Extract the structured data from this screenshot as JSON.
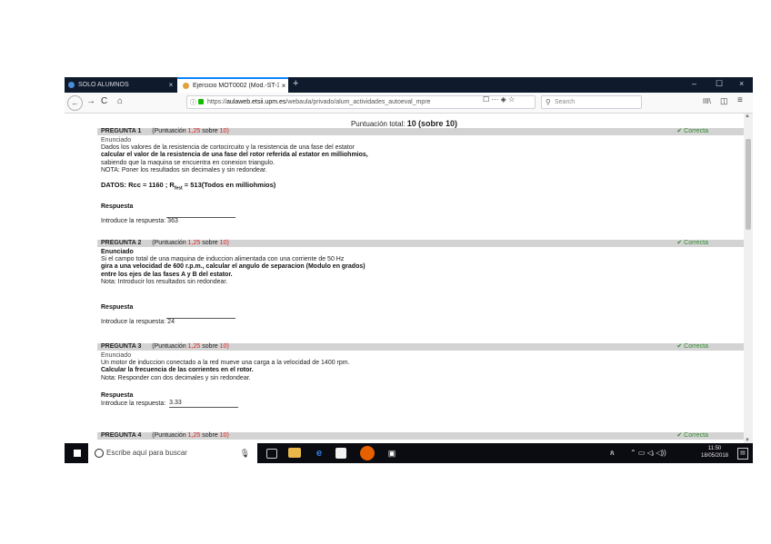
{
  "tabs": [
    {
      "title": "SÓLO ALUMNOS",
      "close": "×"
    },
    {
      "title": "Ejercicio MOT0002 (Mod.-ST-3780)",
      "close": "×"
    }
  ],
  "new_tab": "+",
  "window_controls": [
    "–",
    "☐",
    "×"
  ],
  "nav": {
    "back": "←",
    "forward": "→",
    "reload": "C",
    "home": "⌂",
    "url_prefix": "https://",
    "url_host": "aulaweb.etsii.upm.es",
    "url_path": "/webaula/privado/alum_actividades_autoeval_mpre",
    "page_actions": "☐   ···  ◈  ☆",
    "search_placeholder": "Search",
    "library": "III\\",
    "sidebar": "◫",
    "menu": "≡"
  },
  "quiz": {
    "total_label": "Puntuación total:",
    "total_value": "10",
    "total_of": "(sobre 10)",
    "correct_label": "✔ Correcta",
    "questions": [
      {
        "label": "PREGUNTA 1",
        "points_prefix": "(Puntuación",
        "points_value": "1,25",
        "points_suffix": "sobre",
        "points_max": "10)",
        "enunciado_label": "Enunciado",
        "lines": [
          "Dados los valores de la resistencia de cortocircuito y la resistencia de una fase del estator",
          "calcular el valor de la resistencia de una fase del rotor referida al estator en milliohmios,",
          "sabiendo que la maquina se encuentra en conexion triangulo.",
          "NOTA: Poner los resultados sin decimales y sin redondear."
        ],
        "datos": "DATOS: Rcc = 1160 ; R",
        "datos_sub": "fest",
        "datos_tail": " = 513(Todos en milliohmios)",
        "respuesta_label": "Respuesta",
        "answer_prompt": "Introduce la respuesta:",
        "answer": "363"
      },
      {
        "label": "PREGUNTA 2",
        "points_prefix": "(Puntuación",
        "points_value": "1,25",
        "points_suffix": "sobre",
        "points_max": "10)",
        "enunciado_label": "Enunciado",
        "lines": [
          "Si el campo total de una maquina de induccion alimentada con una corriente de 50 Hz",
          "gira a una velocidad de 600 r.p.m., calcular el angulo de separacion (Modulo en grados)",
          "entre los ejes de las fases A y B del estator.",
          "Nota: Introducir los resultados sin redondear."
        ],
        "respuesta_label": "Respuesta",
        "answer_prompt": "Introduce la respuesta:",
        "answer": "24"
      },
      {
        "label": "PREGUNTA 3",
        "points_prefix": "(Puntuación",
        "points_value": "1,25",
        "points_suffix": "sobre",
        "points_max": "10)",
        "enunciado_label": "Enunciado",
        "lines": [
          "Un motor de induccion conectado a la red mueve una carga a la velocidad de 1400 rpm.",
          "Calcular la frecuencia de las corrientes en el rotor.",
          "Nota: Responder con dos decimales y sin redondear."
        ],
        "respuesta_label": "Respuesta",
        "answer_prompt": "Introduce la respuesta:",
        "answer": "3.33"
      },
      {
        "label": "PREGUNTA 4",
        "points_prefix": "(Puntuación",
        "points_value": "1,25",
        "points_suffix": "sobre",
        "points_max": "10)"
      }
    ]
  },
  "taskbar": {
    "search_placeholder": "Escribe aquí para buscar",
    "mic": "🎙",
    "tray": "⌃   ▭   ◁ᵢ   ◁))",
    "time": "11:50",
    "date": "18/05/2018",
    "notifications": "▤"
  }
}
